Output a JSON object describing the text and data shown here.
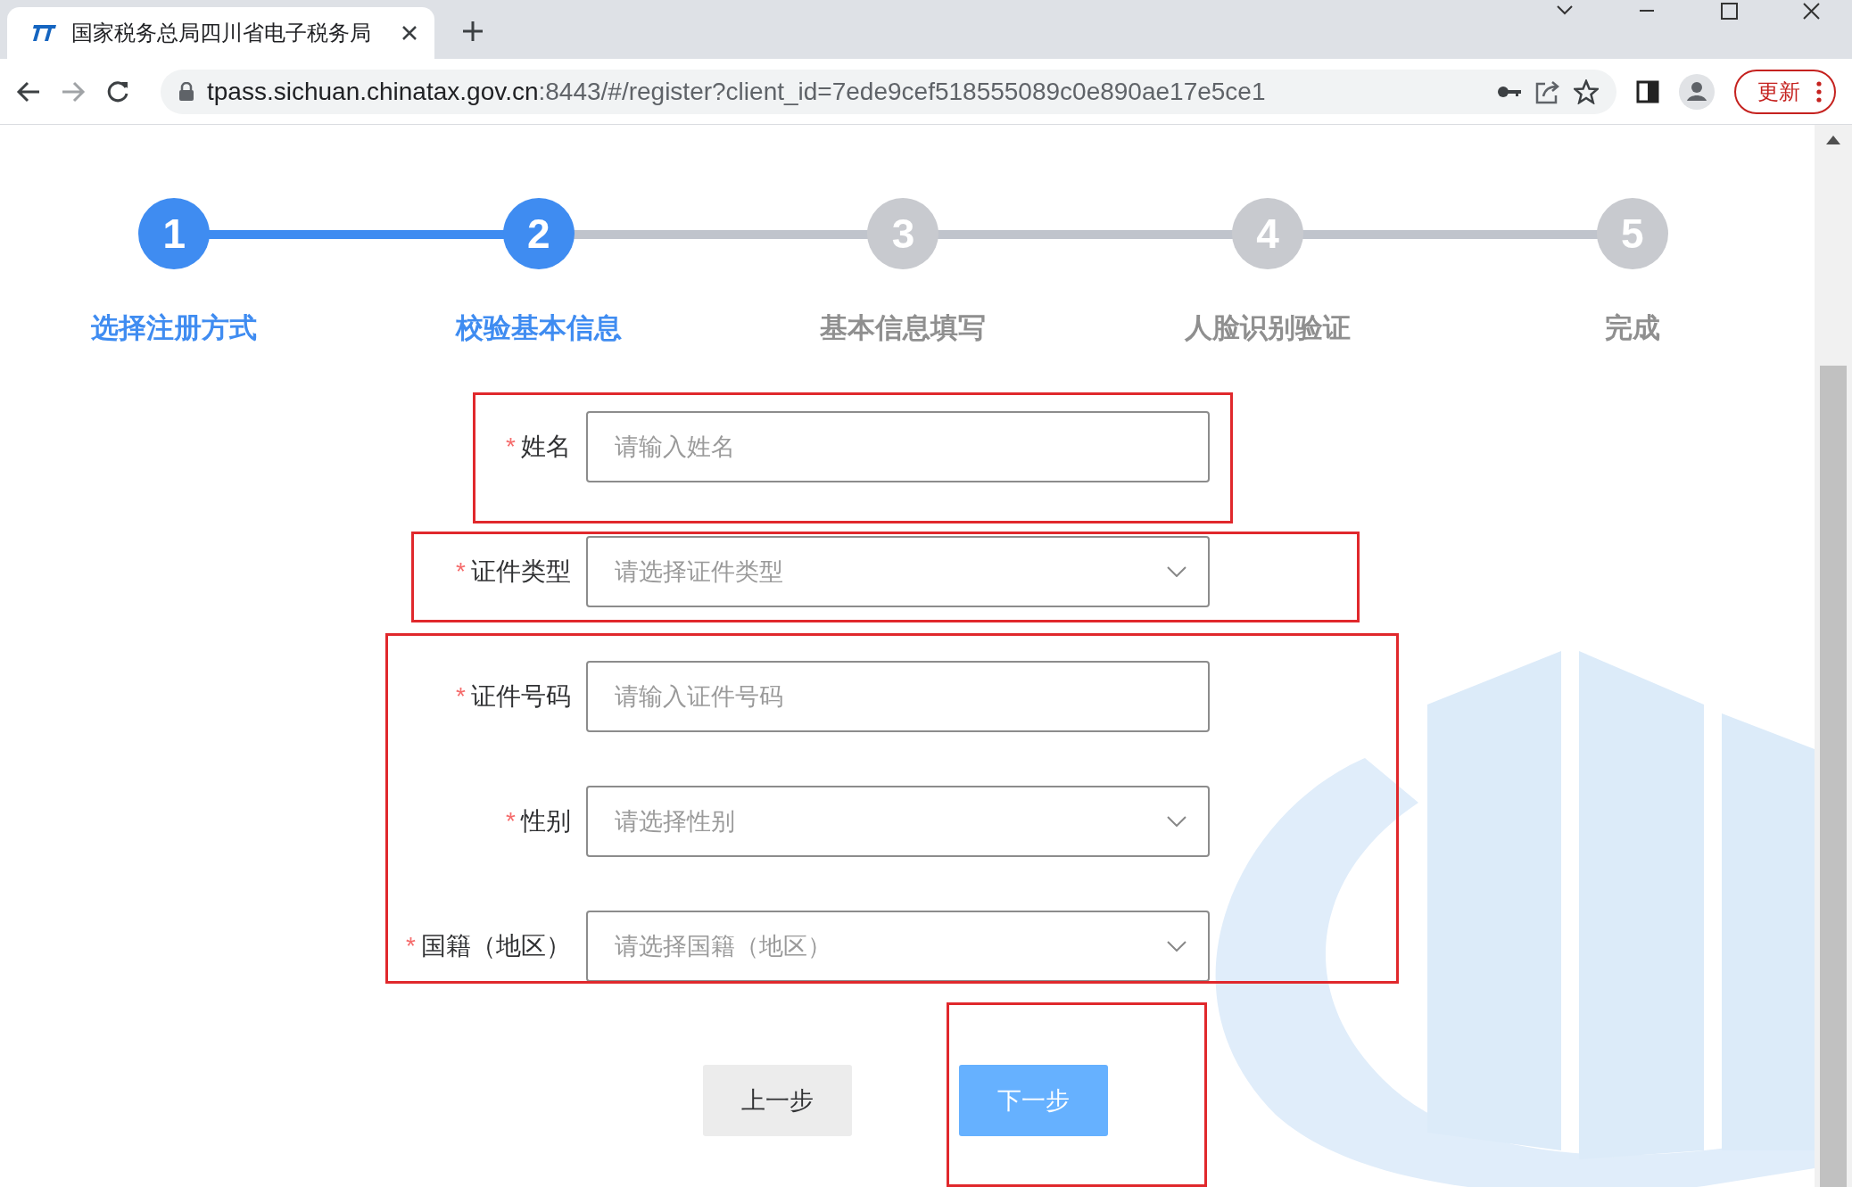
{
  "browser": {
    "tab": {
      "title": "国家税务总局四川省电子税务局"
    },
    "address": {
      "host": "tpass.sichuan.chinatax.gov.cn",
      "path": ":8443/#/register?client_id=7ede9cef518555089c0e890ae17e5ce1"
    },
    "update_button": "更新"
  },
  "steps": [
    {
      "number": "1",
      "label": "选择注册方式",
      "reached": true
    },
    {
      "number": "2",
      "label": "校验基本信息",
      "reached": true
    },
    {
      "number": "3",
      "label": "基本信息填写",
      "reached": false
    },
    {
      "number": "4",
      "label": "人脸识别验证",
      "reached": false
    },
    {
      "number": "5",
      "label": "完成",
      "reached": false
    }
  ],
  "form": {
    "fields": [
      {
        "kind": "input",
        "mark": "*",
        "label": "姓名",
        "placeholder": "请输入姓名"
      },
      {
        "kind": "select",
        "mark": "*",
        "label": "证件类型",
        "placeholder": "请选择证件类型"
      },
      {
        "kind": "input",
        "mark": "*",
        "label": "证件号码",
        "placeholder": "请输入证件号码"
      },
      {
        "kind": "select",
        "mark": "*",
        "label": "性别",
        "placeholder": "请选择性别"
      },
      {
        "kind": "select",
        "mark": "*",
        "label": "国籍（地区）",
        "placeholder": "请选择国籍（地区）"
      }
    ]
  },
  "buttons": [
    {
      "kind": "secondary",
      "label": "上一步"
    },
    {
      "kind": "primary",
      "label": "下一步"
    }
  ]
}
